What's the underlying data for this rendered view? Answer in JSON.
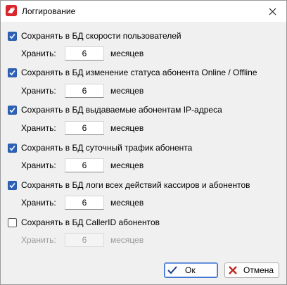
{
  "window": {
    "title": "Логгирование",
    "icon": "app-logo-icon",
    "close_icon": "close-icon"
  },
  "options": [
    {
      "label": "Сохранять в БД скорости пользователей",
      "checked": true,
      "keep_label": "Хранить:",
      "months": "6",
      "unit": "месяцев"
    },
    {
      "label": "Сохранять в БД изменение статуса абонента Online / Offline",
      "checked": true,
      "keep_label": "Хранить:",
      "months": "6",
      "unit": "месяцев"
    },
    {
      "label": "Сохранять в БД выдаваемые абонентам IP-адреса",
      "checked": true,
      "keep_label": "Хранить:",
      "months": "6",
      "unit": "месяцев"
    },
    {
      "label": "Сохранять в БД суточный трафик абонента",
      "checked": true,
      "keep_label": "Хранить:",
      "months": "6",
      "unit": "месяцев"
    },
    {
      "label": "Сохранять в БД логи всех действий кассиров и абонентов",
      "checked": true,
      "keep_label": "Хранить:",
      "months": "6",
      "unit": "месяцев"
    },
    {
      "label": "Сохранять в БД CallerID абонентов",
      "checked": false,
      "keep_label": "Хранить:",
      "months": "6",
      "unit": "месяцев"
    }
  ],
  "buttons": {
    "ok": "Ок",
    "cancel": "Отмена"
  },
  "colors": {
    "checkbox_checked": "#2c63b8",
    "ok_icon": "#1f3f8a",
    "cancel_icon": "#c0271d",
    "title_icon": "#d9262c"
  }
}
